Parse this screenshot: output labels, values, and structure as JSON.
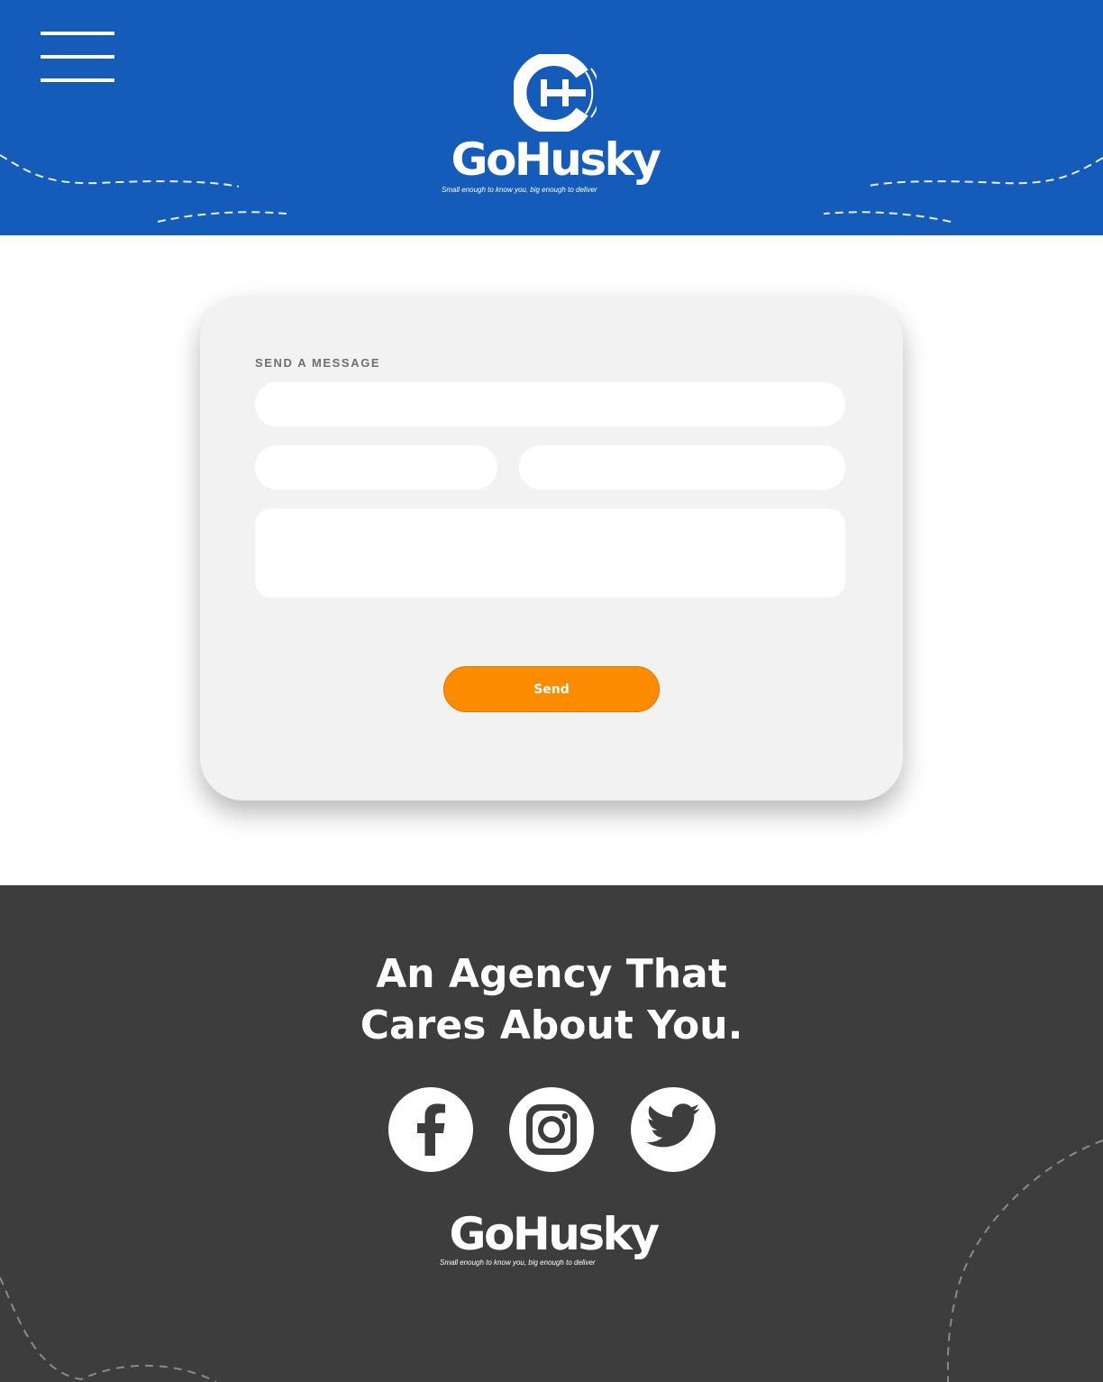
{
  "colors": {
    "header_bg": "#155bba",
    "accent": "#ff8c00",
    "card_bg": "#f2f2f2",
    "footer_bg": "#3d3d3d",
    "text_light": "#ffffff",
    "label_gray": "#6f6f6f"
  },
  "header": {
    "menu_icon": "hamburger-menu-icon",
    "logo": {
      "mark_icon": "gohusky-g-logo-icon",
      "wordmark": "GoHusky",
      "tagline": "Small enough to know you, big enough to deliver"
    }
  },
  "contact_form": {
    "title": "SEND A MESSAGE",
    "fields": {
      "subject": {
        "value": "",
        "placeholder": ""
      },
      "name": {
        "value": "",
        "placeholder": ""
      },
      "email": {
        "value": "",
        "placeholder": ""
      },
      "message": {
        "value": "",
        "placeholder": ""
      }
    },
    "send_label": "Send"
  },
  "footer": {
    "tagline_line1": "An Agency That",
    "tagline_line2": "Cares About You.",
    "social": [
      {
        "icon": "facebook-icon"
      },
      {
        "icon": "instagram-icon"
      },
      {
        "icon": "twitter-icon"
      }
    ],
    "logo": {
      "wordmark": "GoHusky",
      "tagline": "Small enough to know you, big enough to deliver"
    }
  }
}
